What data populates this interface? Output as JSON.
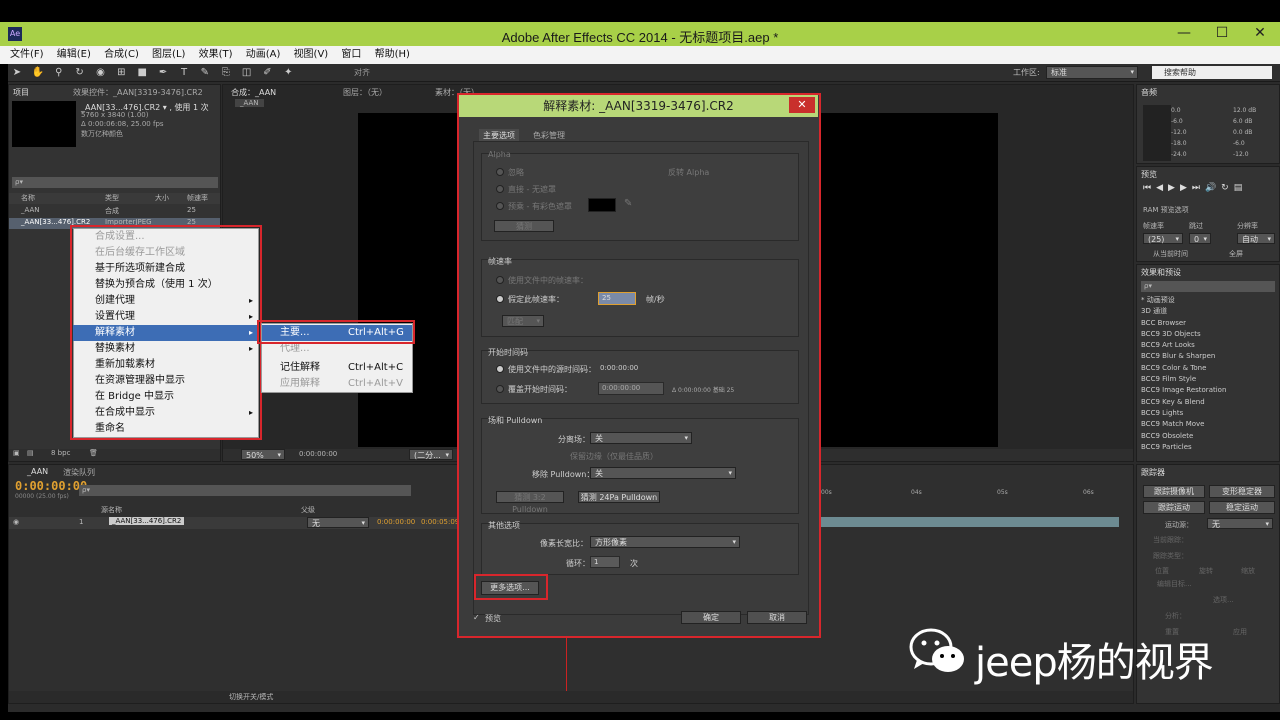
{
  "window": {
    "title": "Adobe After Effects CC 2014 - 无标题项目.aep *",
    "app_icon": "Ae",
    "minimize": "—",
    "maximize": "☐",
    "close": "✕"
  },
  "menu": [
    "文件(F)",
    "编辑(E)",
    "合成(C)",
    "图层(L)",
    "效果(T)",
    "动画(A)",
    "视图(V)",
    "窗口",
    "帮助(H)"
  ],
  "toolbar": {
    "snap_label": "对齐",
    "workspace_label": "工作区:",
    "workspace_value": "标准",
    "search_placeholder": "搜索帮助"
  },
  "project_panel": {
    "tabs": [
      "项目",
      "效果控件：_AAN[3319-3476].CR2"
    ],
    "item_name": "_AAN[33...476].CR2 ▾ , 使用 1 次",
    "item_dims": "5760 x 3840 (1.00)",
    "item_duration": "Δ 0:00:06:08, 25.00 fps",
    "item_colors": "数万亿种颜色",
    "search_placeholder": "ρ▾",
    "columns": [
      "名称",
      "类型",
      "大小",
      "帧速率"
    ],
    "rows": [
      {
        "name": "_AAN",
        "type": "合成",
        "size": "",
        "fps": "25"
      },
      {
        "name": "_AAN[33...476].CR2",
        "type": "ImporterJPEG",
        "size": "",
        "fps": "25"
      }
    ],
    "bpc": "8 bpc"
  },
  "context_menu": {
    "items": [
      {
        "label": "合成设置...",
        "disabled": true,
        "arrow": false
      },
      {
        "label": "在后台缓存工作区域",
        "disabled": true,
        "arrow": false
      },
      {
        "label": "基于所选项新建合成",
        "disabled": false,
        "arrow": false
      },
      {
        "label": "替换为预合成（使用 1 次）",
        "disabled": false,
        "arrow": false
      },
      {
        "label": "创建代理",
        "disabled": false,
        "arrow": true
      },
      {
        "label": "设置代理",
        "disabled": false,
        "arrow": true
      },
      {
        "label": "解释素材",
        "disabled": false,
        "arrow": true,
        "selected": true
      },
      {
        "label": "替换素材",
        "disabled": false,
        "arrow": true
      },
      {
        "label": "重新加载素材",
        "disabled": false,
        "arrow": false
      },
      {
        "label": "在资源管理器中显示",
        "disabled": false,
        "arrow": false
      },
      {
        "label": "在 Bridge 中显示",
        "disabled": false,
        "arrow": false
      },
      {
        "label": "在合成中显示",
        "disabled": false,
        "arrow": true
      },
      {
        "label": "重命名",
        "disabled": false,
        "arrow": false
      }
    ]
  },
  "submenu": {
    "items": [
      {
        "label": "主要...",
        "shortcut": "Ctrl+Alt+G",
        "disabled": false
      },
      {
        "label": "代理...",
        "shortcut": "",
        "disabled": true
      },
      {
        "label": "记住解释",
        "shortcut": "Ctrl+Alt+C",
        "disabled": false
      },
      {
        "label": "应用解释",
        "shortcut": "Ctrl+Alt+V",
        "disabled": true
      }
    ]
  },
  "comp_viewer": {
    "tabs": [
      "合成：_AAN",
      "图层：（无）",
      "素材：（无）"
    ],
    "subtab": "_AAN",
    "zoom": "50%",
    "timecode": "0:00:00:00",
    "resolution": "(二分..."
  },
  "dialog": {
    "title": "解释素材: _AAN[3319-3476].CR2",
    "close": "✕",
    "tabs": [
      "主要选项",
      "色彩管理"
    ],
    "alpha": {
      "label": "Alpha",
      "ignore": "忽略",
      "invert": "反转 Alpha",
      "straight": "直接 - 无遮罩",
      "premult": "预乘 - 有彩色遮罩",
      "guess": "猜测"
    },
    "frame_rate": {
      "label": "帧速率",
      "use_file": "使用文件中的帧速率：",
      "assume": "假定此帧速率：",
      "value": "25",
      "unit": "帧/秒",
      "remap": "匹配"
    },
    "start_timecode": {
      "label": "开始时间码",
      "use_file": "使用文件中的源时间码：",
      "file_value": "0:00:00:00",
      "override": "覆盖开始时间码：",
      "override_value": "0:00:00:00",
      "base_info": "Δ 0:00:00:00  基础 25"
    },
    "fields": {
      "label": "场和 Pulldown",
      "separate_label": "分离场：",
      "separate_value": "关",
      "preserve": "保留边缘（仅最佳品质）",
      "remove_label": "移除 Pulldown：",
      "remove_value": "关",
      "guess_3_2": "猜测 3:2 Pulldown",
      "guess_24pa": "猜测 24Pa Pulldown"
    },
    "other": {
      "label": "其他选项",
      "par_label": "像素长宽比：",
      "par_value": "方形像素",
      "loop_label": "循环：",
      "loop_value": "1",
      "loop_unit": "次"
    },
    "more_options": "更多选项...",
    "preview": "预览",
    "ok": "确定",
    "cancel": "取消"
  },
  "audio_panel": {
    "tab": "音频",
    "db": [
      "0.0",
      "-6.0",
      "-12.0",
      "-18.0",
      "-24.0"
    ],
    "db_r": [
      "12.0 dB",
      "6.0 dB",
      "0.0 dB",
      "-6.0",
      "-12.0"
    ]
  },
  "preview_panel": {
    "tab": "预览",
    "ram_label": "RAM 预览选项",
    "fps_label": "帧速率",
    "skip_label": "跳过",
    "res_label": "分辨率",
    "fps_value": "(25)",
    "skip_value": "0",
    "res_value": "自动",
    "from_current": "从当前时间",
    "fullscreen": "全屏"
  },
  "effects_panel": {
    "tab": "效果和预设",
    "search_placeholder": "ρ▾",
    "items": [
      "* 动画预设",
      "3D 通道",
      "BCC Browser",
      "BCC9 3D Objects",
      "BCC9 Art Looks",
      "BCC9 Blur & Sharpen",
      "BCC9 Color & Tone",
      "BCC9 Film Style",
      "BCC9 Image Restoration",
      "BCC9 Key & Blend",
      "BCC9 Lights",
      "BCC9 Match Move",
      "BCC9 Obsolete",
      "BCC9 Particles"
    ]
  },
  "tracker_panel": {
    "tab": "跟踪器",
    "track_camera": "跟踪摄像机",
    "warp_stabilizer": "变形稳定器",
    "track_motion": "跟踪运动",
    "stabilize_motion": "稳定运动",
    "motion_source_label": "运动源：",
    "motion_source_value": "无",
    "current_track": "当前跟踪：",
    "track_type": "跟踪类型：",
    "position": "位置",
    "rotation": "旋转",
    "scale": "缩放",
    "edit_target": "编辑目标...",
    "options": "选项...",
    "analyze": "分析：",
    "reset": "重置",
    "apply": "应用"
  },
  "timeline": {
    "tabs": [
      "_AAN",
      "渲染队列"
    ],
    "timecode": "0:00:00:00",
    "timecode_sub": "00000 (25.00 fps)",
    "search_placeholder": "ρ▾",
    "col_source": "源名称",
    "col_parent": "父级",
    "layer_num": "1",
    "layer_name": "_AAN[33...476].CR2",
    "layer_parent": "无",
    "in": "0:00:00:00",
    "out": "0:00:05:09",
    "ruler": [
      "00s",
      "04s",
      "05s",
      "06s"
    ],
    "switch_modes": "切换开关/模式"
  },
  "watermark": {
    "text": "jeep杨的视界"
  }
}
